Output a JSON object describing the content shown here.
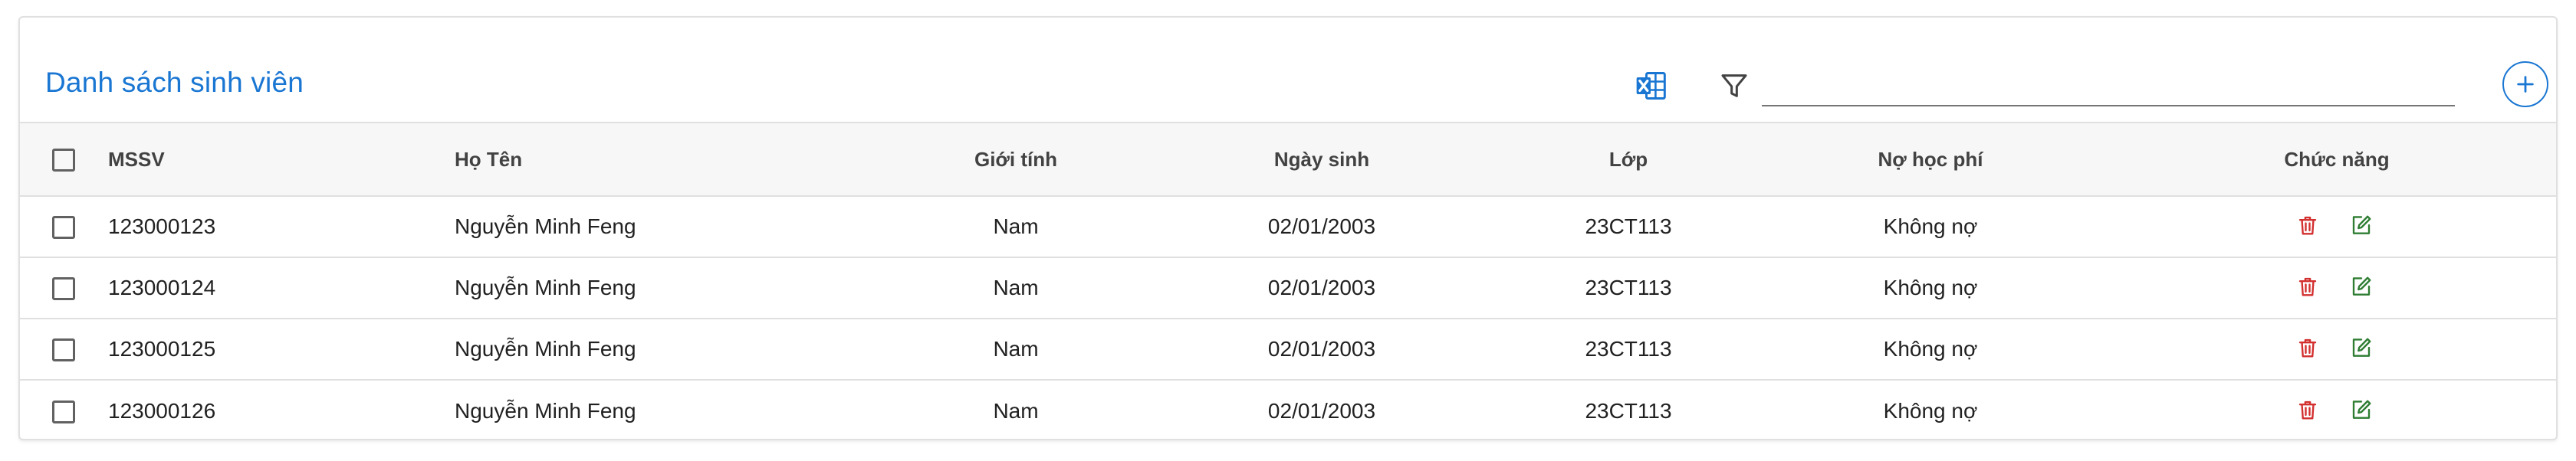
{
  "header": {
    "title": "Danh sách sinh viên",
    "search": {
      "value": "",
      "placeholder": ""
    },
    "icons": [
      "excel-export-icon",
      "filter-icon",
      "add-icon"
    ]
  },
  "table": {
    "columns": {
      "mssv": "MSSV",
      "name": "Họ Tên",
      "gender": "Giới tính",
      "dob": "Ngày sinh",
      "class": "Lớp",
      "fee": "Nợ học phí",
      "actions": "Chức năng"
    },
    "rows": [
      {
        "mssv": "123000123",
        "name": "Nguyễn Minh Feng",
        "gender": "Nam",
        "dob": "02/01/2003",
        "class": "23CT113",
        "fee": "Không nợ"
      },
      {
        "mssv": "123000124",
        "name": "Nguyễn Minh Feng",
        "gender": "Nam",
        "dob": "02/01/2003",
        "class": "23CT113",
        "fee": "Không nợ"
      },
      {
        "mssv": "123000125",
        "name": "Nguyễn Minh Feng",
        "gender": "Nam",
        "dob": "02/01/2003",
        "class": "23CT113",
        "fee": "Không nợ"
      },
      {
        "mssv": "123000126",
        "name": "Nguyễn Minh Feng",
        "gender": "Nam",
        "dob": "02/01/2003",
        "class": "23CT113",
        "fee": "Không nợ"
      }
    ]
  },
  "colors": {
    "primary": "#1976d2",
    "delete": "#d32f2f",
    "edit": "#2e7d32",
    "header_bg": "#f7f7f7"
  }
}
